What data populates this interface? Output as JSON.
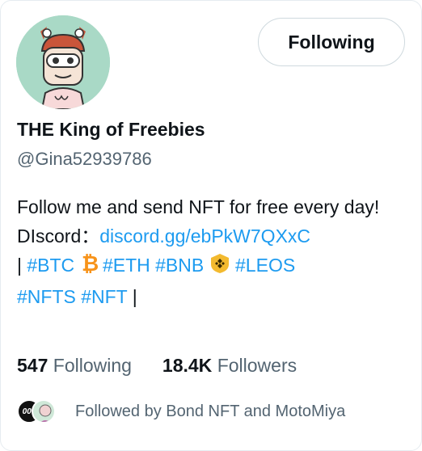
{
  "profile": {
    "name": "THE King of Freebies",
    "handle": "@Gina52939786",
    "follow_button_label": "Following"
  },
  "bio": {
    "line1": "Follow me and send NFT for free every day!",
    "discord_label": "DIscord：",
    "discord_link": "discord.gg/ebPkW7QXxC",
    "pipe_start": "| ",
    "tag_btc": "#BTC",
    "tag_eth": "#ETH",
    "tag_bnb": "#BNB",
    "tag_leos": "#LEOS",
    "tag_nfts": "#NFTS",
    "tag_nft": "#NFT",
    "pipe_end": " |"
  },
  "stats": {
    "following_count": "547",
    "following_label": "Following",
    "followers_count": "18.4K",
    "followers_label": "Followers"
  },
  "followed_by": {
    "text": "Followed by Bond NFT and MotoMiya",
    "avatar1_text": "007"
  },
  "colors": {
    "accent": "#1d9bf0",
    "secondary_text": "#536471",
    "avatar_bg": "#a9d9c6",
    "bitcoin": "#f7931a",
    "binance": "#f3ba2f"
  },
  "icons": [
    "bitcoin-icon",
    "binance-icon"
  ]
}
